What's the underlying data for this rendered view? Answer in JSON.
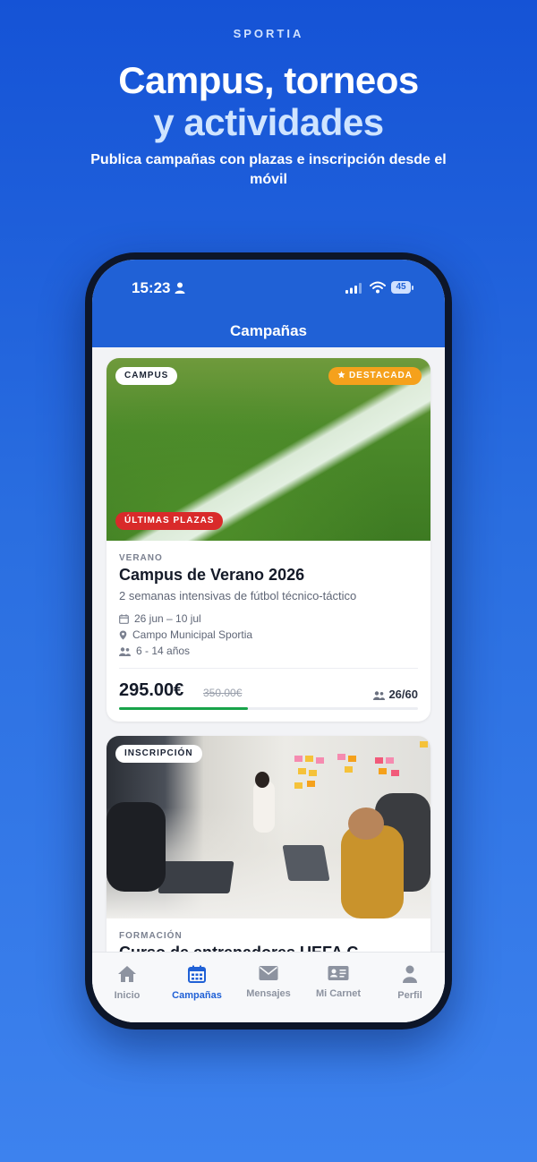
{
  "brand": "SPORTIA",
  "headline": {
    "line1": "Campus, torneos",
    "line2": "y actividades"
  },
  "subline": "Publica campañas con plazas e inscripción desde el móvil",
  "status_bar": {
    "time": "15:23",
    "battery": "45"
  },
  "appbar": {
    "title": "Campañas"
  },
  "cards": [
    {
      "type_badge": "CAMPUS",
      "featured_badge": "DESTACADA",
      "urgency_badge": "ÚLTIMAS PLAZAS",
      "category": "VERANO",
      "title": "Campus de Verano 2026",
      "description": "2 semanas intensivas de fútbol técnico-táctico",
      "dates": "26 jun – 10 jul",
      "location": "Campo Municipal Sportia",
      "ages": "6 - 14 años",
      "price": "295.00€",
      "old_price": "350.00€",
      "spots": "26/60",
      "fill_fraction": 0.43,
      "image": "football-pitch-photo"
    },
    {
      "type_badge": "INSCRIPCIÓN",
      "category": "FORMACIÓN",
      "title": "Curso de entrenadores UEFA C",
      "image": "meeting-room-photo"
    }
  ],
  "tabs": [
    {
      "label": "Inicio",
      "icon": "home-icon",
      "active": false
    },
    {
      "label": "Campañas",
      "icon": "calendar-icon",
      "active": true
    },
    {
      "label": "Mensajes",
      "icon": "envelope-icon",
      "active": false
    },
    {
      "label": "Mi Carnet",
      "icon": "id-card-icon",
      "active": false
    },
    {
      "label": "Perfil",
      "icon": "user-icon",
      "active": false
    }
  ],
  "colors": {
    "primary": "#2061d6",
    "featured": "#f5a11c",
    "urgent": "#d92a2a",
    "progress": "#18a34a"
  }
}
